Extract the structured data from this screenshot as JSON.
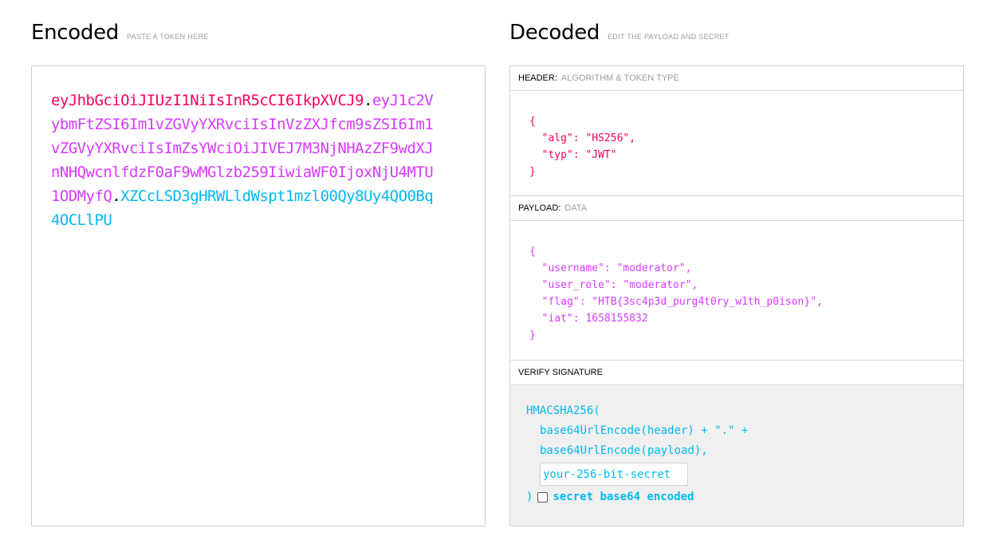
{
  "encoded": {
    "title": "Encoded",
    "subtitle": "PASTE A TOKEN HERE",
    "token_header": "eyJhbGciOiJIUzI1NiIsInR5cCI6IkpXVCJ9",
    "token_payload": "eyJ1c2VybmFtZSI6Im1vZGVyYXRvciIsInVzZXJfcm9sZSI6Im1vZGVyYXRvciIsImZsYWciOiJIVEJ7M3NjNHAzZF9wdXJnNHQwcnlfdzF0aF9wMGlzb259IiwiaWF0IjoxNjU4MTU1ODMyfQ",
    "token_signature": "XZCcLSD3gHRWLldWspt1mzl00Qy8Uy4QO0Bq4OCLlPU",
    "dot": "."
  },
  "decoded": {
    "title": "Decoded",
    "subtitle": "EDIT THE PAYLOAD AND SECRET",
    "header_section": {
      "label": "HEADER:",
      "description": "ALGORITHM & TOKEN TYPE",
      "json_text": "{\n  \"alg\": \"HS256\",\n  \"typ\": \"JWT\"\n}"
    },
    "payload_section": {
      "label": "PAYLOAD:",
      "description": "DATA",
      "json_text": "{\n  \"username\": \"moderator\",\n  \"user_role\": \"moderator\",\n  \"flag\": \"HTB{3sc4p3d_purg4t0ry_w1th_p0ison}\",\n  \"iat\": 1658155832\n}"
    },
    "verify_section": {
      "label": "VERIFY SIGNATURE",
      "fn_open": "HMACSHA256(",
      "line1": "base64UrlEncode(header) + \".\" +",
      "line2": "base64UrlEncode(payload),",
      "secret_placeholder": "your-256-bit-secret",
      "close_paren": ")",
      "base64_checkbox_label": "secret base64 encoded",
      "base64_checked": false
    }
  },
  "colors": {
    "header": "#fb015b",
    "payload": "#d63aff",
    "signature": "#00b9f1"
  }
}
